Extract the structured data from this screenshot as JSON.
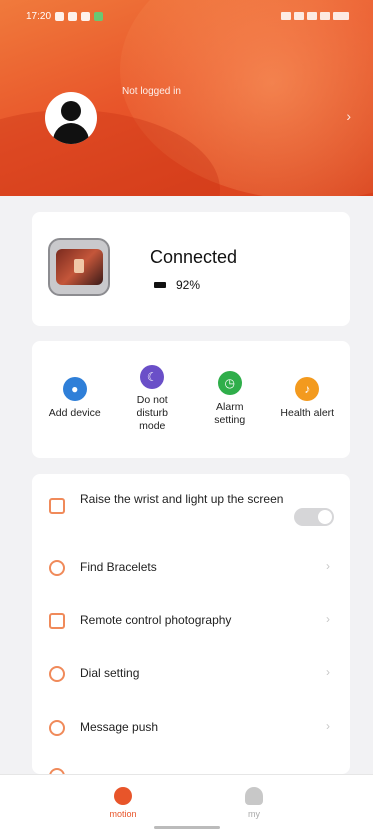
{
  "status_bar": {
    "time": "17:20"
  },
  "header": {
    "login_text": "Not logged in",
    "chevron": "›"
  },
  "device": {
    "status": "Connected",
    "battery": "92%"
  },
  "quick_actions": [
    {
      "label": "Add device",
      "icon": "add-device-icon",
      "color": "#2f7fd8"
    },
    {
      "label": "Do not disturb mode",
      "icon": "moon-icon",
      "color": "#6a4fc8"
    },
    {
      "label": "Alarm setting",
      "icon": "alarm-icon",
      "color": "#2fae4a"
    },
    {
      "label": "Health alert",
      "icon": "bell-icon",
      "color": "#f39a1e"
    }
  ],
  "settings": [
    {
      "label": "Raise the wrist and light up the screen",
      "type": "toggle",
      "on": false
    },
    {
      "label": "Find Bracelets",
      "type": "link"
    },
    {
      "label": "Remote control photography",
      "type": "link"
    },
    {
      "label": "Dial setting",
      "type": "link"
    },
    {
      "label": "Message push",
      "type": "link"
    }
  ],
  "tabs": [
    {
      "label": "motion",
      "active": true
    },
    {
      "label": "my",
      "active": false
    }
  ],
  "colors": {
    "accent": "#e8552a",
    "icon_orange": "#f08a5a"
  }
}
